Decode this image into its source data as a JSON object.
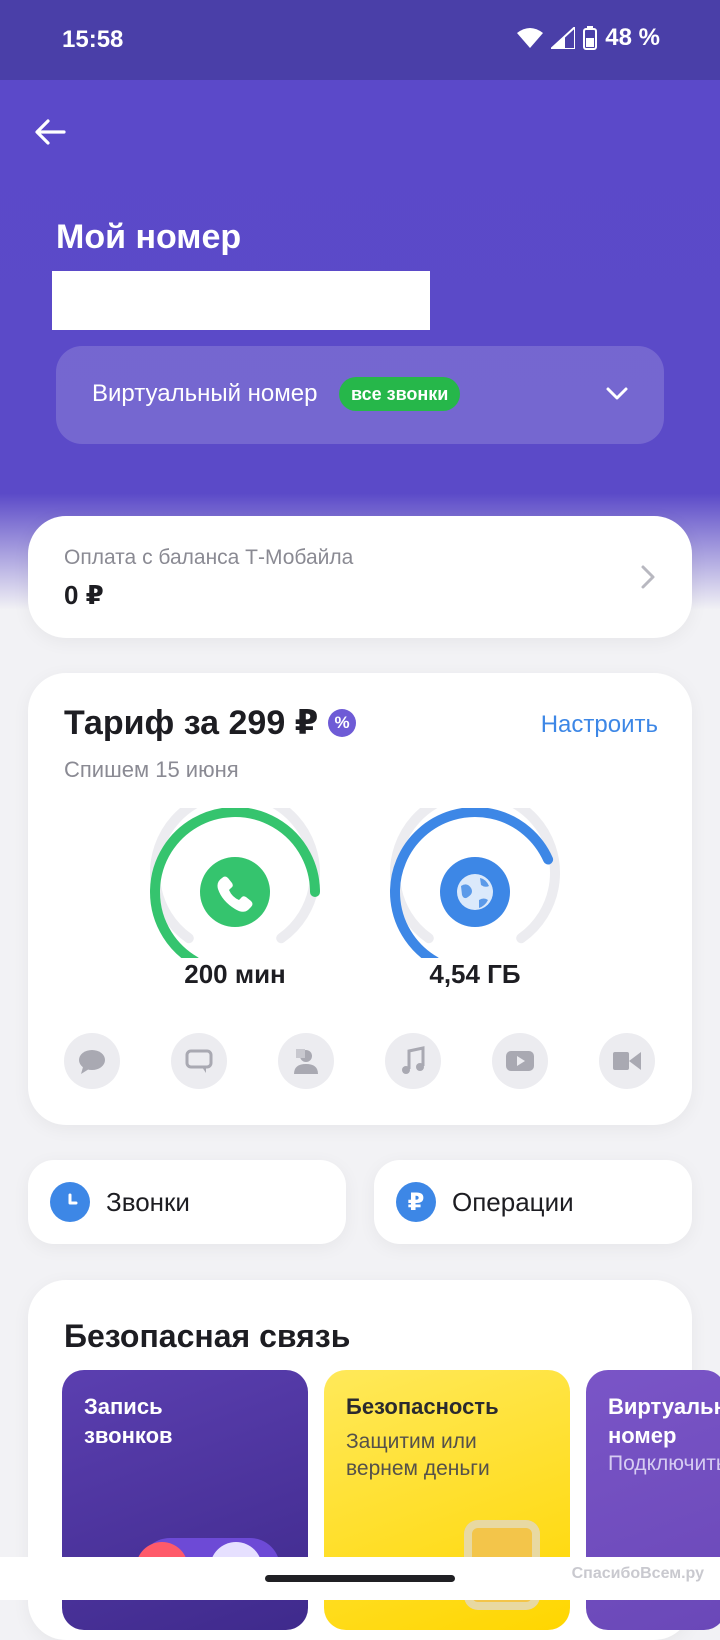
{
  "status_bar": {
    "time": "15:58",
    "battery": "48 %"
  },
  "header": {
    "title": "Мой номер",
    "number_value": ""
  },
  "virtual_number": {
    "label": "Виртуальный номер",
    "badge": "все звонки"
  },
  "balance": {
    "label": "Оплата с баланса Т-Мобайла",
    "value": "0 ₽"
  },
  "tariff": {
    "title": "Тариф за 299 ₽",
    "percent_symbol": "%",
    "setup_label": "Настроить",
    "charge_date": "Спишем 15 июня",
    "minutes": {
      "label": "200 мин",
      "fill_fraction": 1.0,
      "color": "#35c46e"
    },
    "data": {
      "label": "4,54 ГБ",
      "fill_fraction": 0.9,
      "color": "#3d87e6"
    },
    "services": [
      "chat-bubble-icon",
      "message-icon",
      "contacts-icon",
      "music-icon",
      "video-play-icon",
      "video-camera-icon"
    ]
  },
  "quick": {
    "calls": "Звонки",
    "operations": "Операции",
    "operations_symbol": "₽"
  },
  "safe_connection": {
    "title": "Безопасная связь",
    "promos": [
      {
        "title": "Запись\nзвонков",
        "subtitle": ""
      },
      {
        "title": "Безопасность",
        "subtitle": "Защитим или\nвернем деньги"
      },
      {
        "title": "Виртуальный\nномер",
        "subtitle": "Подключить"
      }
    ]
  },
  "watermark": "СпасибоВсем.ру",
  "colors": {
    "hero": "#5b49c9",
    "status": "#4a3fa8",
    "accent_blue": "#3d87e6",
    "green": "#35c46e"
  }
}
